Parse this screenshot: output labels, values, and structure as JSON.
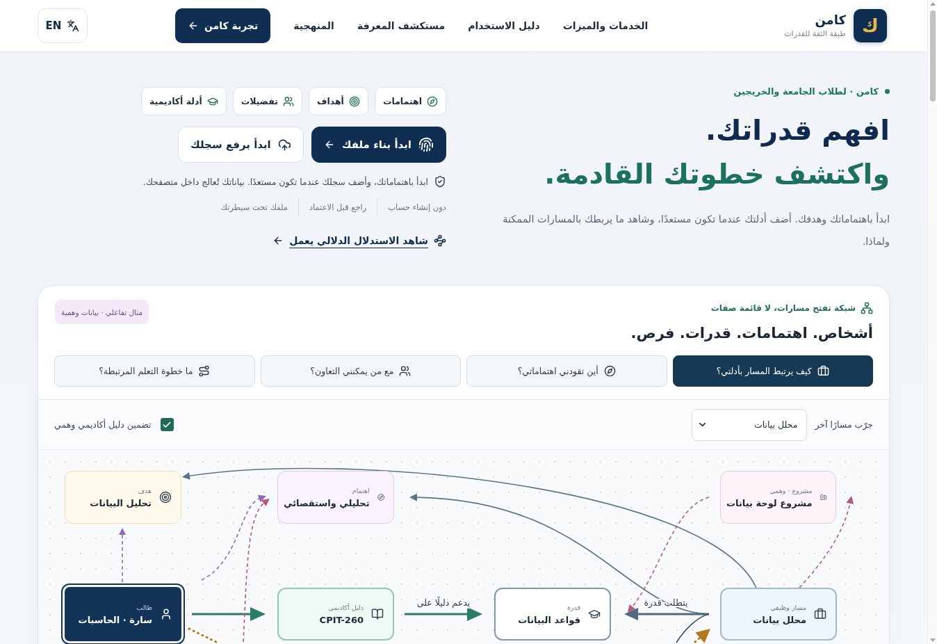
{
  "header": {
    "logo_mark": "ك",
    "brand": "كامن",
    "tagline": "طبقة الثقة للقدرات",
    "nav": [
      "الخدمات والميزات",
      "دليل الاستخدام",
      "مستكشف المعرفة",
      "المنهجية"
    ],
    "cta": "تجربة كامن",
    "language": "EN"
  },
  "hero": {
    "eyebrow": "كامن · لطلاب الجامعة والخريجين",
    "title_line_1": "افهم قدراتك.",
    "title_line_2": "واكتشف خطوتك القادمة.",
    "description": "ابدأ باهتماماتك وهدفك. أضف أدلتك عندما تكون مستعدًا، وشاهد ما يربطك بالمسارات الممكنة ولماذا.",
    "chips": [
      "اهتمامات",
      "أهداف",
      "تفضيلات",
      "أدلة أكاديمية"
    ],
    "primary_button": "ابدأ بناء ملفك",
    "secondary_button": "ابدأ برفع سجلك",
    "privacy_note": "ابدأ باهتماماتك، وأضف سجلك عندما تكون مستعدًا. بياناتك تُعالج داخل متصفحك.",
    "features": [
      "دون إنشاء حساب",
      "راجع قبل الاعتماد",
      "ملفك تحت سيطرتك"
    ],
    "demo_link": "شاهد الاستدلال الدلالي يعمل"
  },
  "demo": {
    "eyebrow": "شبكة تفتح مسارات، لا قائمة صفات",
    "title": "أشخاص. اهتمامات. قدرات. فرص.",
    "badge": "مثال تفاعلي · بيانات وهمية",
    "tabs": [
      {
        "label": "كيف يرتبط المسار بأدلتي؟",
        "selected": true
      },
      {
        "label": "أين تقودني اهتماماتي؟",
        "selected": false
      },
      {
        "label": "مع من يمكنني التعاون؟",
        "selected": false
      },
      {
        "label": "ما خطوة التعلم المرتبطة؟",
        "selected": false
      }
    ],
    "path_label": "جرّب مسارًا آخر",
    "path_select": {
      "value": "محلل بيانات"
    },
    "academic_toggle": {
      "label": "تضمين دليل أكاديمي وهمي",
      "checked": true
    },
    "graph": {
      "nodes": [
        {
          "kind": "project",
          "type_label": "مشروع · وهمي",
          "title": "مشروع لوحة بيانات",
          "selected": false
        },
        {
          "kind": "interest",
          "type_label": "اهتمام",
          "title": "تحليلي واستقصائي",
          "selected": false
        },
        {
          "kind": "goal",
          "type_label": "هدف",
          "title": "تحليل البيانات",
          "selected": false
        },
        {
          "kind": "career",
          "type_label": "مسار وظيفي",
          "title": "محلل بيانات",
          "selected": false
        },
        {
          "kind": "skill",
          "type_label": "قدرة",
          "title": "قواعد البيانات",
          "selected": false
        },
        {
          "kind": "evidence",
          "type_label": "دليل أكاديمي",
          "title": "CPIT-260",
          "selected": false
        },
        {
          "kind": "student",
          "type_label": "طالب",
          "title": "سارة · الحاسبات",
          "selected": true
        }
      ],
      "edge_labels": [
        "يتطلب قدرة",
        "يدعم دليلًا على"
      ]
    }
  }
}
